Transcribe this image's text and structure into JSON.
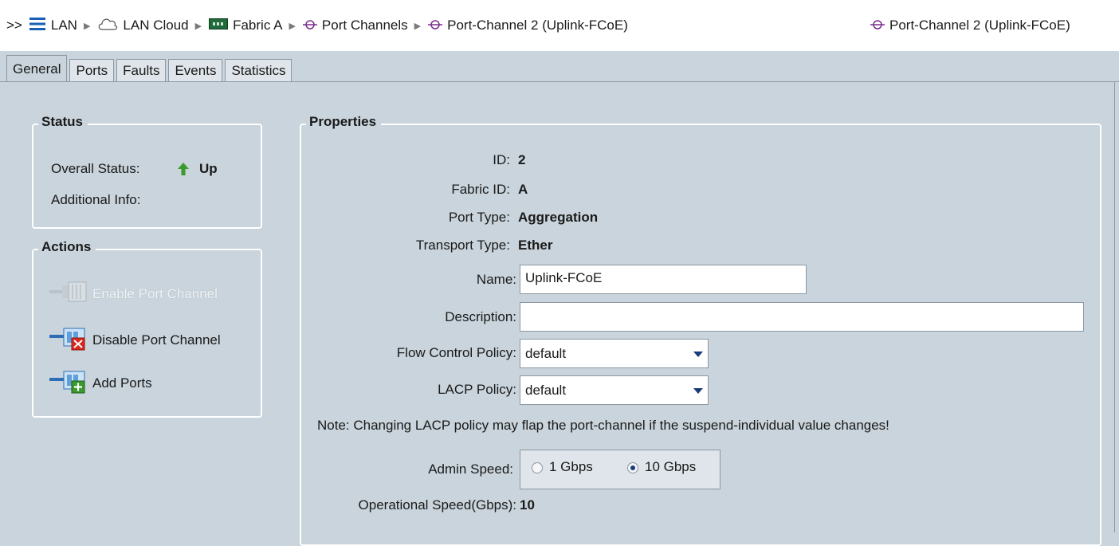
{
  "breadcrumb": {
    "prefix": ">>",
    "items": [
      {
        "label": "LAN",
        "icon": "lan-icon"
      },
      {
        "label": "LAN Cloud",
        "icon": "cloud-icon"
      },
      {
        "label": "Fabric A",
        "icon": "fabric-icon"
      },
      {
        "label": "Port Channels",
        "icon": "port-channel-icon"
      },
      {
        "label": "Port-Channel 2 (Uplink-FCoE)",
        "icon": "port-channel-icon"
      }
    ]
  },
  "window_title": "Port-Channel 2 (Uplink-FCoE)",
  "tabs": [
    {
      "label": "General",
      "active": true
    },
    {
      "label": "Ports",
      "active": false
    },
    {
      "label": "Faults",
      "active": false
    },
    {
      "label": "Events",
      "active": false
    },
    {
      "label": "Statistics",
      "active": false
    }
  ],
  "status": {
    "title": "Status",
    "overall_label": "Overall Status:",
    "overall_value": "Up",
    "overall_icon": "up-arrow-icon",
    "additional_label": "Additional Info:"
  },
  "actions": {
    "title": "Actions",
    "items": [
      {
        "label": "Enable Port Channel",
        "icon": "enable-port-channel-icon",
        "enabled": false
      },
      {
        "label": "Disable Port Channel",
        "icon": "disable-port-channel-icon",
        "enabled": true
      },
      {
        "label": "Add Ports",
        "icon": "add-ports-icon",
        "enabled": true
      }
    ]
  },
  "properties": {
    "title": "Properties",
    "id_label": "ID:",
    "id_value": "2",
    "fabric_label": "Fabric ID:",
    "fabric_value": "A",
    "port_type_label": "Port Type:",
    "port_type_value": "Aggregation",
    "transport_label": "Transport Type:",
    "transport_value": "Ether",
    "name_label": "Name:",
    "name_value": "Uplink-FCoE",
    "description_label": "Description:",
    "description_value": "",
    "flow_label": "Flow Control Policy:",
    "flow_value": "default",
    "lacp_label": "LACP Policy:",
    "lacp_value": "default",
    "note": "Note: Changing LACP policy may flap the port-channel if the suspend-individual value changes!",
    "admin_speed_label": "Admin Speed:",
    "admin_speed_options": [
      "1 Gbps",
      "10 Gbps"
    ],
    "admin_speed_selected": "10 Gbps",
    "op_speed_label": "Operational Speed(Gbps):",
    "op_speed_value": "10"
  },
  "colors": {
    "background": "#c9d4dc",
    "status_up": "#3a9a2c",
    "port_channel_icon": "#7b2d8e",
    "link": "#1a3a78"
  }
}
